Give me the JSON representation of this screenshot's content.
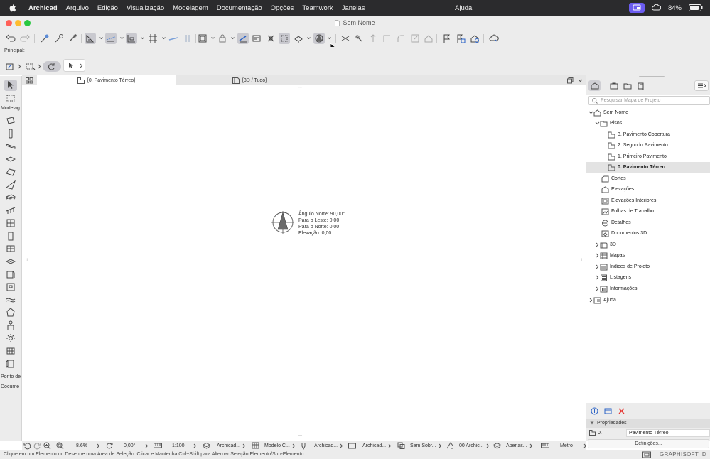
{
  "menubar": {
    "app_name": "Archicad",
    "items": [
      "Arquivo",
      "Edição",
      "Visualização",
      "Modelagem",
      "Documentação",
      "Opções",
      "Teamwork",
      "Janelas"
    ],
    "help": "Ajuda",
    "battery": "84%"
  },
  "window": {
    "title": "Sem Nome"
  },
  "toolbar": {
    "principal_label": "Principal:"
  },
  "toolbox": {
    "section_modeling": "Modelag",
    "section_ponto": "Ponto de",
    "section_docume": "Docume"
  },
  "tabs": [
    {
      "label": "[0. Pavimento Térreo]",
      "active": true
    },
    {
      "label": "[3D / Tudo]",
      "active": false
    }
  ],
  "compass": {
    "angle": "Ângulo Norte: 90,00°",
    "east": "Para o Leste: 0,00",
    "north": "Para o Norte: 0,00",
    "elevation": "Elevação: 0,00"
  },
  "navigator": {
    "search_placeholder": "Pesquisar Mapa de Projeto",
    "tree": [
      {
        "label": "Sem Nome",
        "level": 0,
        "expanded": true,
        "icon": "project-icon"
      },
      {
        "label": "Pisos",
        "level": 1,
        "expanded": true,
        "icon": "folder-icon"
      },
      {
        "label": "3. Pavimento Cobertura",
        "level": 2,
        "icon": "story-icon"
      },
      {
        "label": "2. Segundo Pavimento",
        "level": 2,
        "icon": "story-icon"
      },
      {
        "label": "1. Primeiro Pavimento",
        "level": 2,
        "icon": "story-icon"
      },
      {
        "label": "0. Pavimento Térreo",
        "level": 2,
        "icon": "story-icon",
        "selected": true
      },
      {
        "label": "Cortes",
        "level": 1,
        "icon": "section-icon"
      },
      {
        "label": "Elevações",
        "level": 1,
        "icon": "elevation-icon"
      },
      {
        "label": "Elevações Interiores",
        "level": 1,
        "icon": "interior-elevation-icon"
      },
      {
        "label": "Folhas de Trabalho",
        "level": 1,
        "icon": "worksheet-icon"
      },
      {
        "label": "Detalhes",
        "level": 1,
        "icon": "detail-icon"
      },
      {
        "label": "Documentos 3D",
        "level": 1,
        "icon": "document-3d-icon"
      },
      {
        "label": "3D",
        "level": 1,
        "collapsed": true,
        "icon": "cube-icon"
      },
      {
        "label": "Mapas",
        "level": 1,
        "collapsed": true,
        "icon": "schedule-icon"
      },
      {
        "label": "Índices de Projeto",
        "level": 1,
        "collapsed": true,
        "icon": "index-icon"
      },
      {
        "label": "Listagens",
        "level": 1,
        "collapsed": true,
        "icon": "list-icon"
      },
      {
        "label": "Informações",
        "level": 1,
        "collapsed": true,
        "icon": "info-icon"
      },
      {
        "label": "Ajuda",
        "level": 0,
        "collapsed": true,
        "icon": "help-book-icon"
      }
    ],
    "properties_label": "Propriedades",
    "prop_id": "0.",
    "prop_value": "Pavimento Térreo",
    "settings_button": "Definições..."
  },
  "quickbar": {
    "zoom": "8.6%",
    "angle": "0,00°",
    "scale": "1:100",
    "layer_combo": "Archicad...",
    "model_view": "Modelo C...",
    "pen_set": "Archicad...",
    "dimension": "Archicad...",
    "override": "Sem Sobr...",
    "renovation": "00 Archic...",
    "structure": "Apenas...",
    "units": "Metro"
  },
  "statusbar": {
    "message": "Clique em um Elemento ou Desenhe uma Área de Seleção. Clicar e Mantenha Ctrl+Shift para Alternar Seleção Elemento/Sub-Elemento.",
    "brand": "GRAPHISOFT ID"
  },
  "colors": {
    "menubar": "#2b2b2d",
    "accent": "#6b5cf0",
    "close": "#ff5f57",
    "minimize": "#febc2e",
    "maximize": "#28c840"
  }
}
